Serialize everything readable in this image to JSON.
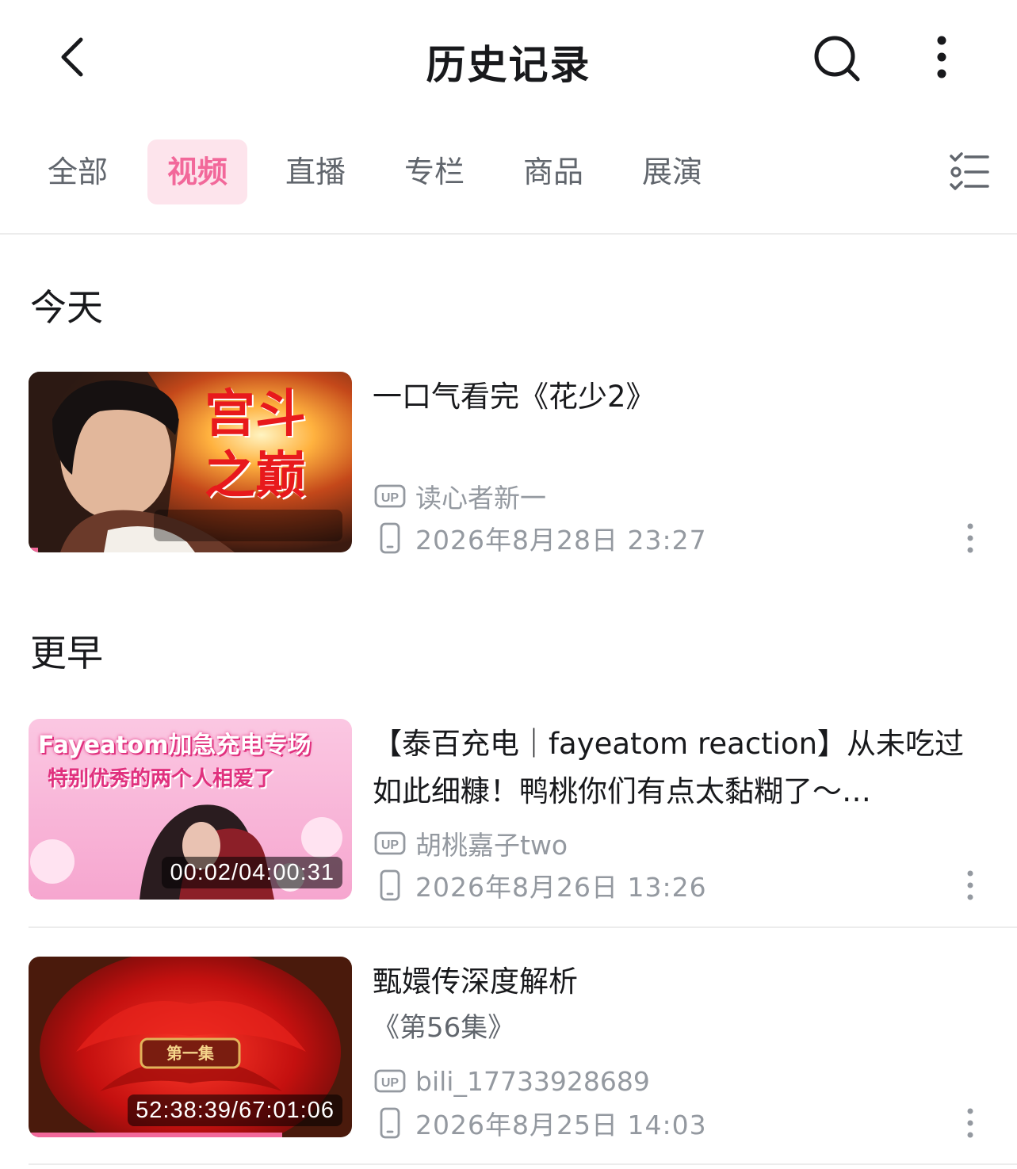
{
  "header": {
    "title": "历史记录",
    "back_icon": "chevron-left-icon",
    "search_icon": "search-icon",
    "more_icon": "more-vertical-icon"
  },
  "tabs": [
    {
      "label": "全部",
      "active": false
    },
    {
      "label": "视频",
      "active": true
    },
    {
      "label": "直播",
      "active": false
    },
    {
      "label": "专栏",
      "active": false
    },
    {
      "label": "商品",
      "active": false
    },
    {
      "label": "展演",
      "active": false
    }
  ],
  "filter_icon": "checklist-filter-icon",
  "colors": {
    "accent": "#f2689a",
    "accent_bg": "#fde4ec",
    "text_primary": "#18191c",
    "text_secondary": "#9499a0"
  },
  "sections": [
    {
      "title": "今天",
      "items": [
        {
          "title": "一口气看完《花少2》",
          "thumb_text_1": "宫斗",
          "thumb_text_2": "之巅",
          "uploader": "读心者新一",
          "timestamp": "2026年8月28日 23:27",
          "watch_progress": 0.03,
          "device_icon": "phone-icon",
          "up_icon": "up-badge-icon"
        }
      ]
    },
    {
      "title": "更早",
      "items": [
        {
          "title": "【泰百充电｜fayeatom reaction】从未吃过如此细糠！鸭桃你们有点太黏糊了～…",
          "thumb_text_1": "Fayeatom加急充电专场",
          "thumb_text_2": "特别优秀的两个人相爱了",
          "duration": "00:02/04:00:31",
          "uploader": "胡桃嘉子two",
          "timestamp": "2026年8月26日 13:26",
          "watch_progress": 0.01,
          "device_icon": "phone-icon",
          "up_icon": "up-badge-icon"
        },
        {
          "title": "甄嬛传深度解析",
          "subtitle": "《第56集》",
          "thumb_text_1": "第一集",
          "duration": "52:38:39/67:01:06",
          "uploader": "bili_17733928689",
          "timestamp": "2026年8月25日 14:03",
          "watch_progress": 0.785,
          "device_icon": "phone-icon",
          "up_icon": "up-badge-icon"
        }
      ]
    }
  ]
}
